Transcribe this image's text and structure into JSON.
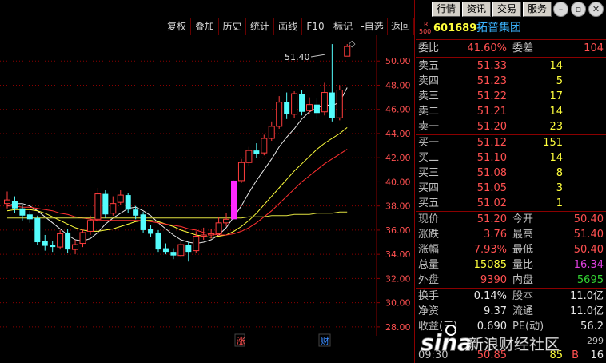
{
  "toolbar": {
    "buttons": [
      "复权",
      "叠加",
      "历史",
      "统计",
      "画线",
      "F10",
      "标记",
      "-自选",
      "返回"
    ]
  },
  "topbar": {
    "buttons": [
      "行情",
      "资讯",
      "交易",
      "服务"
    ],
    "window_icons": [
      "minimize-icon",
      "restore-icon",
      "close-icon"
    ]
  },
  "chart": {
    "price_axis": [
      "50.00",
      "48.00",
      "46.00",
      "44.00",
      "42.00",
      "40.00",
      "38.00",
      "36.00",
      "34.00",
      "32.00",
      "30.00",
      "28.00"
    ],
    "high_label": "51.40",
    "markers": [
      {
        "label": "涨",
        "color": "#ff5050"
      },
      {
        "label": "财",
        "color": "#3c8cff"
      }
    ]
  },
  "chart_data": {
    "type": "candlestick",
    "title": "",
    "ylim": [
      27.0,
      52.0
    ],
    "candles": [
      {
        "o": 38.2,
        "c": 38.5,
        "h": 39.2,
        "l": 37.8
      },
      {
        "o": 38.4,
        "c": 37.8,
        "h": 38.8,
        "l": 37.4
      },
      {
        "o": 37.8,
        "c": 37.2,
        "h": 38.1,
        "l": 36.8
      },
      {
        "o": 37.3,
        "c": 36.9,
        "h": 37.6,
        "l": 36.6
      },
      {
        "o": 37.0,
        "c": 35.0,
        "h": 37.2,
        "l": 34.8
      },
      {
        "o": 35.1,
        "c": 34.7,
        "h": 35.6,
        "l": 34.3
      },
      {
        "o": 34.8,
        "c": 34.6,
        "h": 35.1,
        "l": 34.2
      },
      {
        "o": 34.6,
        "c": 35.7,
        "h": 36.0,
        "l": 34.4
      },
      {
        "o": 35.8,
        "c": 34.4,
        "h": 36.1,
        "l": 34.1
      },
      {
        "o": 34.4,
        "c": 34.8,
        "h": 35.2,
        "l": 34.0
      },
      {
        "o": 34.9,
        "c": 35.8,
        "h": 36.1,
        "l": 34.6
      },
      {
        "o": 35.9,
        "c": 36.8,
        "h": 37.2,
        "l": 35.6
      },
      {
        "o": 36.9,
        "c": 39.0,
        "h": 39.5,
        "l": 36.7
      },
      {
        "o": 39.0,
        "c": 37.3,
        "h": 39.3,
        "l": 37.0
      },
      {
        "o": 37.4,
        "c": 38.2,
        "h": 38.8,
        "l": 37.2
      },
      {
        "o": 38.3,
        "c": 38.9,
        "h": 39.3,
        "l": 38.1
      },
      {
        "o": 38.9,
        "c": 37.7,
        "h": 39.1,
        "l": 37.4
      },
      {
        "o": 37.7,
        "c": 37.2,
        "h": 38.0,
        "l": 36.9
      },
      {
        "o": 37.3,
        "c": 36.0,
        "h": 37.5,
        "l": 35.8
      },
      {
        "o": 36.1,
        "c": 35.7,
        "h": 36.4,
        "l": 35.4
      },
      {
        "o": 35.8,
        "c": 34.4,
        "h": 36.0,
        "l": 34.2
      },
      {
        "o": 34.5,
        "c": 34.2,
        "h": 34.9,
        "l": 34.0
      },
      {
        "o": 34.2,
        "c": 33.9,
        "h": 34.5,
        "l": 33.6
      },
      {
        "o": 33.9,
        "c": 34.8,
        "h": 35.1,
        "l": 33.8
      },
      {
        "o": 34.8,
        "c": 34.2,
        "h": 35.0,
        "l": 33.4
      },
      {
        "o": 34.3,
        "c": 35.5,
        "h": 35.9,
        "l": 34.1
      },
      {
        "o": 35.5,
        "c": 35.6,
        "h": 36.2,
        "l": 35.2
      },
      {
        "o": 35.6,
        "c": 35.7,
        "h": 36.1,
        "l": 35.3
      },
      {
        "o": 35.7,
        "c": 36.6,
        "h": 37.1,
        "l": 35.6
      },
      {
        "o": 36.6,
        "c": 36.9,
        "h": 37.4,
        "l": 36.3
      },
      {
        "o": 36.9,
        "c": 40.1,
        "h": 40.1,
        "l": 36.9,
        "limit": true
      },
      {
        "o": 40.1,
        "c": 41.6,
        "h": 41.9,
        "l": 39.9
      },
      {
        "o": 41.6,
        "c": 42.6,
        "h": 42.9,
        "l": 41.3
      },
      {
        "o": 42.6,
        "c": 42.3,
        "h": 43.2,
        "l": 42.0
      },
      {
        "o": 42.4,
        "c": 43.6,
        "h": 43.9,
        "l": 42.2
      },
      {
        "o": 43.6,
        "c": 44.6,
        "h": 45.0,
        "l": 43.4
      },
      {
        "o": 44.6,
        "c": 46.6,
        "h": 47.1,
        "l": 44.4
      },
      {
        "o": 46.6,
        "c": 45.6,
        "h": 47.4,
        "l": 45.2
      },
      {
        "o": 45.6,
        "c": 47.3,
        "h": 47.5,
        "l": 45.3
      },
      {
        "o": 47.3,
        "c": 45.8,
        "h": 47.6,
        "l": 45.5
      },
      {
        "o": 45.9,
        "c": 46.4,
        "h": 47.0,
        "l": 45.6
      },
      {
        "o": 46.4,
        "c": 45.7,
        "h": 46.9,
        "l": 45.2
      },
      {
        "o": 45.8,
        "c": 47.4,
        "h": 48.2,
        "l": 45.5
      },
      {
        "o": 47.4,
        "c": 45.3,
        "h": 51.4,
        "l": 45.0
      },
      {
        "o": 45.3,
        "c": 47.6,
        "h": 48.0,
        "l": 45.1
      },
      {
        "o": 50.4,
        "c": 51.2,
        "h": 51.4,
        "l": 50.4
      }
    ],
    "moving_averages": [
      {
        "color": "#e8e8e8",
        "values": [
          38.0,
          38.2,
          38.2,
          38.0,
          37.6,
          37.1,
          36.6,
          36.1,
          35.6,
          35.2,
          35.1,
          35.3,
          35.8,
          36.5,
          37.0,
          37.4,
          37.8,
          37.9,
          37.6,
          37.2,
          36.6,
          36.1,
          35.6,
          35.2,
          35.0,
          34.9,
          35.0,
          35.2,
          35.6,
          36.2,
          37.1,
          38.0,
          39.1,
          40.1,
          41.0,
          41.9,
          42.9,
          43.7,
          44.4,
          45.2,
          45.8,
          46.1,
          46.4,
          46.3,
          46.6,
          47.8
        ]
      },
      {
        "color": "#ffff3c",
        "values": [
          37.6,
          37.7,
          37.7,
          37.7,
          37.6,
          37.4,
          37.1,
          36.8,
          36.5,
          36.2,
          36.0,
          35.9,
          35.9,
          36.0,
          36.1,
          36.3,
          36.5,
          36.7,
          36.8,
          36.8,
          36.7,
          36.5,
          36.3,
          36.0,
          35.8,
          35.6,
          35.5,
          35.4,
          35.5,
          35.6,
          35.9,
          36.3,
          36.8,
          37.4,
          38.1,
          38.8,
          39.5,
          40.2,
          40.9,
          41.5,
          42.1,
          42.7,
          43.2,
          43.6,
          44.0,
          44.5
        ]
      },
      {
        "color": "#ff3030",
        "values": [
          38.0,
          38.0,
          37.9,
          37.9,
          37.8,
          37.7,
          37.6,
          37.4,
          37.3,
          37.1,
          37.0,
          36.9,
          36.8,
          36.8,
          36.8,
          36.8,
          36.8,
          36.8,
          36.8,
          36.7,
          36.6,
          36.5,
          36.4,
          36.3,
          36.1,
          36.0,
          35.8,
          35.7,
          35.6,
          35.6,
          35.7,
          35.9,
          36.2,
          36.6,
          37.1,
          37.6,
          38.2,
          38.8,
          39.4,
          40.0,
          40.5,
          41.0,
          41.5,
          41.9,
          42.3,
          42.7
        ]
      },
      {
        "color": "#e0e040",
        "values": [
          37.0,
          37.0,
          37.0,
          37.0,
          37.0,
          37.0,
          37.0,
          37.0,
          37.0,
          37.0,
          37.0,
          37.0,
          37.0,
          37.0,
          37.0,
          37.0,
          37.0,
          37.0,
          37.0,
          37.0,
          37.0,
          37.0,
          37.0,
          37.0,
          37.0,
          37.0,
          37.0,
          37.0,
          37.0,
          37.0,
          37.0,
          37.0,
          37.1,
          37.1,
          37.1,
          37.2,
          37.2,
          37.2,
          37.3,
          37.3,
          37.3,
          37.4,
          37.4,
          37.4,
          37.5,
          37.5
        ]
      }
    ]
  },
  "stock": {
    "badge_top": "R",
    "badge_bottom": "500",
    "code": "601689",
    "name": "拓普集团"
  },
  "quote": {
    "weibi_label": "委比",
    "weibi": "41.60%",
    "weicha_label": "委差",
    "weicha": "104",
    "sell": [
      {
        "label": "卖五",
        "price": "51.33",
        "vol": "14"
      },
      {
        "label": "卖四",
        "price": "51.23",
        "vol": "5"
      },
      {
        "label": "卖三",
        "price": "51.22",
        "vol": "17"
      },
      {
        "label": "卖二",
        "price": "51.21",
        "vol": "14"
      },
      {
        "label": "卖一",
        "price": "51.20",
        "vol": "23"
      }
    ],
    "buy": [
      {
        "label": "买一",
        "price": "51.12",
        "vol": "151"
      },
      {
        "label": "买二",
        "price": "51.10",
        "vol": "14"
      },
      {
        "label": "买三",
        "price": "51.08",
        "vol": "8"
      },
      {
        "label": "买四",
        "price": "51.05",
        "vol": "3"
      },
      {
        "label": "买五",
        "price": "51.02",
        "vol": "1"
      }
    ],
    "stats": [
      {
        "l1": "现价",
        "v1": "51.20",
        "c1": "red",
        "l2": "今开",
        "v2": "50.40",
        "c2": "red"
      },
      {
        "l1": "涨跌",
        "v1": "3.76",
        "c1": "red",
        "l2": "最高",
        "v2": "51.40",
        "c2": "red"
      },
      {
        "l1": "涨幅",
        "v1": "7.93%",
        "c1": "red",
        "l2": "最低",
        "v2": "50.40",
        "c2": "red"
      },
      {
        "l1": "总量",
        "v1": "15085",
        "c1": "yel",
        "l2": "量比",
        "v2": "16.34",
        "c2": "mag"
      },
      {
        "l1": "外盘",
        "v1": "9390",
        "c1": "red",
        "l2": "内盘",
        "v2": "5695",
        "c2": "grn"
      }
    ],
    "fund": [
      {
        "l1": "换手",
        "v1": "0.14%",
        "l2": "股本",
        "v2": "11.0亿"
      },
      {
        "l1": "净资",
        "v1": "9.37",
        "l2": "流通",
        "v2": "11.0亿"
      },
      {
        "l1": "收益(三)",
        "v1": "0.690",
        "l2": "PE(动)",
        "v2": "56.2"
      }
    ],
    "partial_right": "299",
    "tick": {
      "time": "09:30",
      "price": "50.85",
      "vol": "85",
      "flag": "B",
      "count": "16"
    }
  },
  "watermark": {
    "brand": "sina",
    "text": "新浪财经社区"
  }
}
